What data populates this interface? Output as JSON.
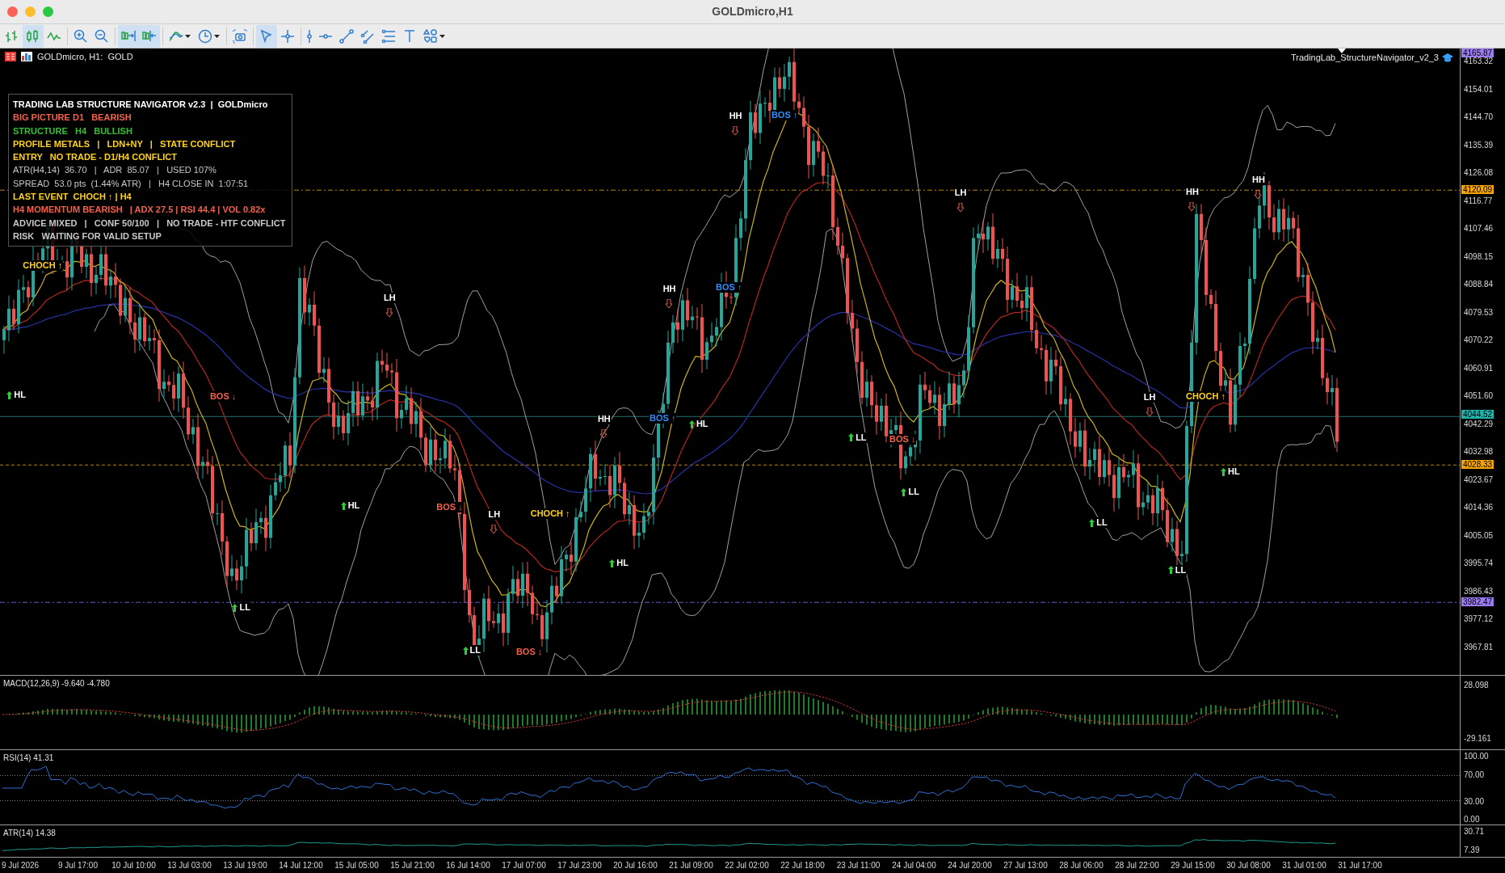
{
  "window": {
    "title": "GOLDmicro,H1"
  },
  "toolbar": [
    {
      "kind": "bars",
      "selected": false
    },
    {
      "kind": "candles",
      "selected": true
    },
    {
      "kind": "line",
      "selected": false
    },
    {
      "kind": "zoom-in",
      "selected": false
    },
    {
      "kind": "zoom-out",
      "selected": false
    },
    {
      "kind": "autoscroll",
      "selected": true
    },
    {
      "kind": "shift",
      "selected": true
    },
    {
      "kind": "indicators",
      "selected": false
    },
    {
      "kind": "clock",
      "selected": false
    },
    {
      "kind": "screenshot",
      "selected": false
    },
    {
      "kind": "cursor",
      "selected": true
    },
    {
      "kind": "crosshair",
      "selected": false
    },
    {
      "kind": "vline",
      "selected": false
    },
    {
      "kind": "hline",
      "selected": false
    },
    {
      "kind": "trend",
      "selected": false
    },
    {
      "kind": "channel",
      "selected": false
    },
    {
      "kind": "fibo",
      "selected": false
    },
    {
      "kind": "text",
      "selected": false
    },
    {
      "kind": "shapes",
      "selected": false
    }
  ],
  "chart": {
    "symbol": "GOLDmicro, H1:  GOLD",
    "indicator_name": "TradingLab_StructureNavigator_v2_3",
    "panel": [
      {
        "text": "TRADING LAB STRUCTURE NAVIGATOR v2.3  |  GOLDmicro",
        "color": "#ffffff",
        "bold": true
      },
      {
        "text": "BIG PICTURE D1   BEARISH",
        "color": "#f2604c",
        "bold": true
      },
      {
        "text": "STRUCTURE   H4   BULLISH",
        "color": "#34c234",
        "bold": true
      },
      {
        "text": "PROFILE METALS   |   LDN+NY   |   STATE CONFLICT",
        "color": "#ffd21a",
        "bold": true
      },
      {
        "text": "ENTRY   NO TRADE - D1/H4 CONFLICT",
        "color": "#ffd21a",
        "bold": true
      },
      {
        "text": "ATR(H4,14)  36.70   |   ADR  85.07   |   USED 107%",
        "color": "#c8c8c8",
        "bold": false
      },
      {
        "text": "SPREAD  53.0 pts  (1.44% ATR)   |   H4 CLOSE IN  1:07:51",
        "color": "#c8c8c8",
        "bold": false
      },
      {
        "text": "LAST EVENT  CHOCH ↑ | H4",
        "color": "#ffd21a",
        "bold": true
      },
      {
        "text": "H4 MOMENTUM BEARISH   | ADX 27.5 | RSI 44.4 | VOL 0.82x",
        "color": "#f2604c",
        "bold": true
      },
      {
        "text": "ADVICE MIXED   |   CONF 50/100   |   NO TRADE - HTF CONFLICT",
        "color": "#c8c8c8",
        "bold": true
      },
      {
        "text": "RISK   WAITING FOR VALID SETUP",
        "color": "#c8c8c8",
        "bold": true
      }
    ],
    "markers": [
      {
        "text": "CHOCH ↑",
        "kind": "event",
        "color": "#ffd21a"
      },
      {
        "text": "HL",
        "kind": "low",
        "color": "#ffffff"
      },
      {
        "text": "BOS ↓",
        "kind": "event",
        "color": "#f2604c"
      },
      {
        "text": "LL",
        "kind": "low",
        "color": "#ffffff"
      },
      {
        "text": "LH",
        "kind": "high",
        "color": "#ffffff"
      },
      {
        "text": "HL",
        "kind": "low",
        "color": "#ffffff"
      },
      {
        "text": "BOS ↓",
        "kind": "event",
        "color": "#f2604c"
      },
      {
        "text": "LH",
        "kind": "high",
        "color": "#ffffff"
      },
      {
        "text": "CHOCH ↑",
        "kind": "event",
        "color": "#ffd21a"
      },
      {
        "text": "LL",
        "kind": "low",
        "color": "#ffffff"
      },
      {
        "text": "BOS ↓",
        "kind": "event",
        "color": "#f2604c"
      },
      {
        "text": "HL",
        "kind": "low",
        "color": "#ffffff"
      },
      {
        "text": "HH",
        "kind": "high",
        "color": "#ffffff"
      },
      {
        "text": "BOS ↑",
        "kind": "event",
        "color": "#2f8cff"
      },
      {
        "text": "HL",
        "kind": "low",
        "color": "#ffffff"
      },
      {
        "text": "HH",
        "kind": "high",
        "color": "#ffffff"
      },
      {
        "text": "BOS ↑",
        "kind": "event",
        "color": "#2f8cff"
      },
      {
        "text": "HH",
        "kind": "high",
        "color": "#ffffff"
      },
      {
        "text": "BOS ↑",
        "kind": "event",
        "color": "#2f8cff"
      },
      {
        "text": "LH",
        "kind": "high",
        "color": "#ffffff"
      },
      {
        "text": "LL",
        "kind": "low",
        "color": "#ffffff"
      },
      {
        "text": "BOS ↓",
        "kind": "event",
        "color": "#f2604c"
      },
      {
        "text": "LL",
        "kind": "low",
        "color": "#ffffff"
      },
      {
        "text": "LH",
        "kind": "high",
        "color": "#ffffff"
      },
      {
        "text": "CHOCH ↑",
        "kind": "event",
        "color": "#ffd21a"
      },
      {
        "text": "LL",
        "kind": "low",
        "color": "#ffffff"
      },
      {
        "text": "LL",
        "kind": "low",
        "color": "#ffffff"
      },
      {
        "text": "HH",
        "kind": "high",
        "color": "#ffffff"
      },
      {
        "text": "HH",
        "kind": "high",
        "color": "#ffffff"
      },
      {
        "text": "HL",
        "kind": "low",
        "color": "#ffffff"
      }
    ],
    "price_ticks": [
      "4163.32",
      "4154.01",
      "4144.70",
      "4135.39",
      "4126.08",
      "4116.77",
      "4107.46",
      "4098.15",
      "4088.84",
      "4079.53",
      "4070.22",
      "4060.91",
      "4051.60",
      "4042.29",
      "4032.98",
      "4023.67",
      "4014.36",
      "4005.05",
      "3995.74",
      "3986.43",
      "3977.12",
      "3967.81"
    ],
    "price_tags": [
      {
        "text": "4165.87",
        "color": "#9b7cf0"
      },
      {
        "text": "4120.09",
        "color": "#f5a300"
      },
      {
        "text": "4044.52",
        "color": "#20b2aa"
      },
      {
        "text": "4028.33",
        "color": "#f5a300"
      },
      {
        "text": "3982.47",
        "color": "#9b7cf0"
      }
    ]
  },
  "macd": {
    "label": "MACD(12,26,9) -9.640 -4.780",
    "ticks": [
      "28.098",
      "-29.161"
    ]
  },
  "rsi": {
    "label": "RSI(14) 41.31",
    "ticks": [
      "100.00",
      "70.00",
      "30.00",
      "0.00"
    ]
  },
  "atr": {
    "label": "ATR(14) 14.38",
    "ticks": [
      "30.71",
      "7.39"
    ]
  },
  "time_axis": [
    "9 Jul 2026",
    "9 Jul 17:00",
    "10 Jul 10:00",
    "13 Jul 03:00",
    "13 Jul 19:00",
    "14 Jul 12:00",
    "15 Jul 05:00",
    "15 Jul 21:00",
    "16 Jul 14:00",
    "17 Jul 07:00",
    "17 Jul 23:00",
    "20 Jul 16:00",
    "21 Jul 09:00",
    "22 Jul 02:00",
    "22 Jul 18:00",
    "23 Jul 11:00",
    "24 Jul 04:00",
    "24 Jul 20:00",
    "27 Jul 13:00",
    "28 Jul 06:00",
    "28 Jul 22:00",
    "29 Jul 15:00",
    "30 Jul 08:00",
    "31 Jul 01:00",
    "31 Jul 17:00"
  ]
}
